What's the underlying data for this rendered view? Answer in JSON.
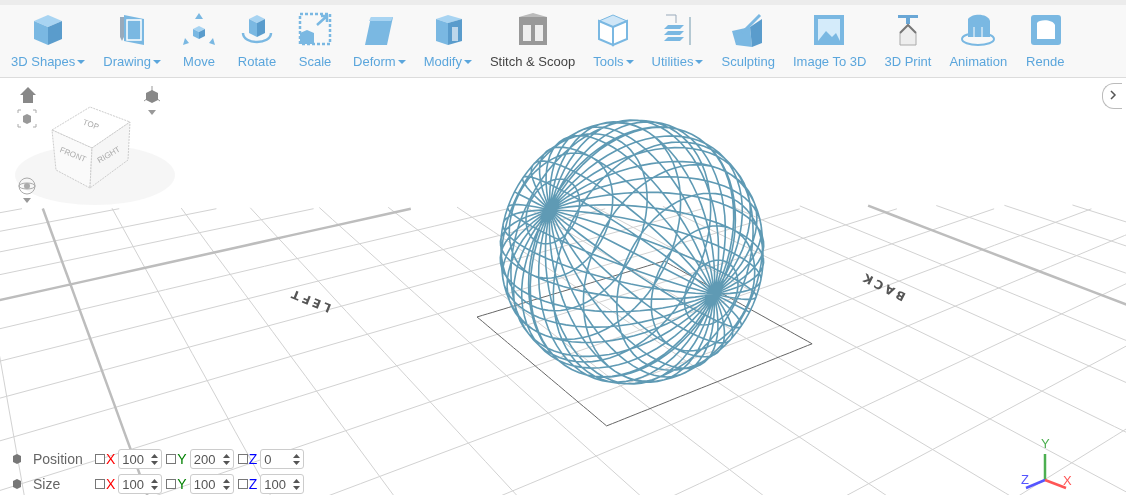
{
  "toolbar": {
    "items": [
      {
        "label": "3D Shapes",
        "dropdown": true,
        "selected": false
      },
      {
        "label": "Drawing",
        "dropdown": true,
        "selected": false
      },
      {
        "label": "Move",
        "dropdown": false,
        "selected": false
      },
      {
        "label": "Rotate",
        "dropdown": false,
        "selected": false
      },
      {
        "label": "Scale",
        "dropdown": false,
        "selected": false
      },
      {
        "label": "Deform",
        "dropdown": true,
        "selected": false
      },
      {
        "label": "Modify",
        "dropdown": true,
        "selected": false
      },
      {
        "label": "Stitch & Scoop",
        "dropdown": false,
        "selected": true
      },
      {
        "label": "Tools",
        "dropdown": true,
        "selected": false
      },
      {
        "label": "Utilities",
        "dropdown": true,
        "selected": false
      },
      {
        "label": "Sculpting",
        "dropdown": false,
        "selected": false
      },
      {
        "label": "Image To 3D",
        "dropdown": false,
        "selected": false
      },
      {
        "label": "3D Print",
        "dropdown": false,
        "selected": false
      },
      {
        "label": "Animation",
        "dropdown": false,
        "selected": false
      },
      {
        "label": "Rende",
        "dropdown": false,
        "selected": false
      }
    ]
  },
  "view_cube": {
    "faces": [
      "TOP",
      "FRONT",
      "RIGHT"
    ]
  },
  "scene": {
    "floor_labels": [
      "LEFT",
      "BACK"
    ],
    "axes": [
      {
        "label": "Y",
        "color": "#4caf50"
      },
      {
        "label": "Z",
        "color": "#5555ff"
      },
      {
        "label": "X",
        "color": "#ff5555"
      }
    ]
  },
  "transform": {
    "rows": [
      {
        "label": "Position",
        "axes": [
          {
            "name": "X",
            "color": "#ff0000",
            "checked": false,
            "value": "100"
          },
          {
            "name": "Y",
            "color": "#008000",
            "checked": false,
            "value": "200"
          },
          {
            "name": "Z",
            "color": "#0000ff",
            "checked": false,
            "value": "0"
          }
        ]
      },
      {
        "label": "Size",
        "axes": [
          {
            "name": "X",
            "color": "#ff0000",
            "checked": false,
            "value": "100"
          },
          {
            "name": "Y",
            "color": "#008000",
            "checked": false,
            "value": "100"
          },
          {
            "name": "Z",
            "color": "#0000ff",
            "checked": false,
            "value": "100"
          }
        ]
      }
    ]
  }
}
